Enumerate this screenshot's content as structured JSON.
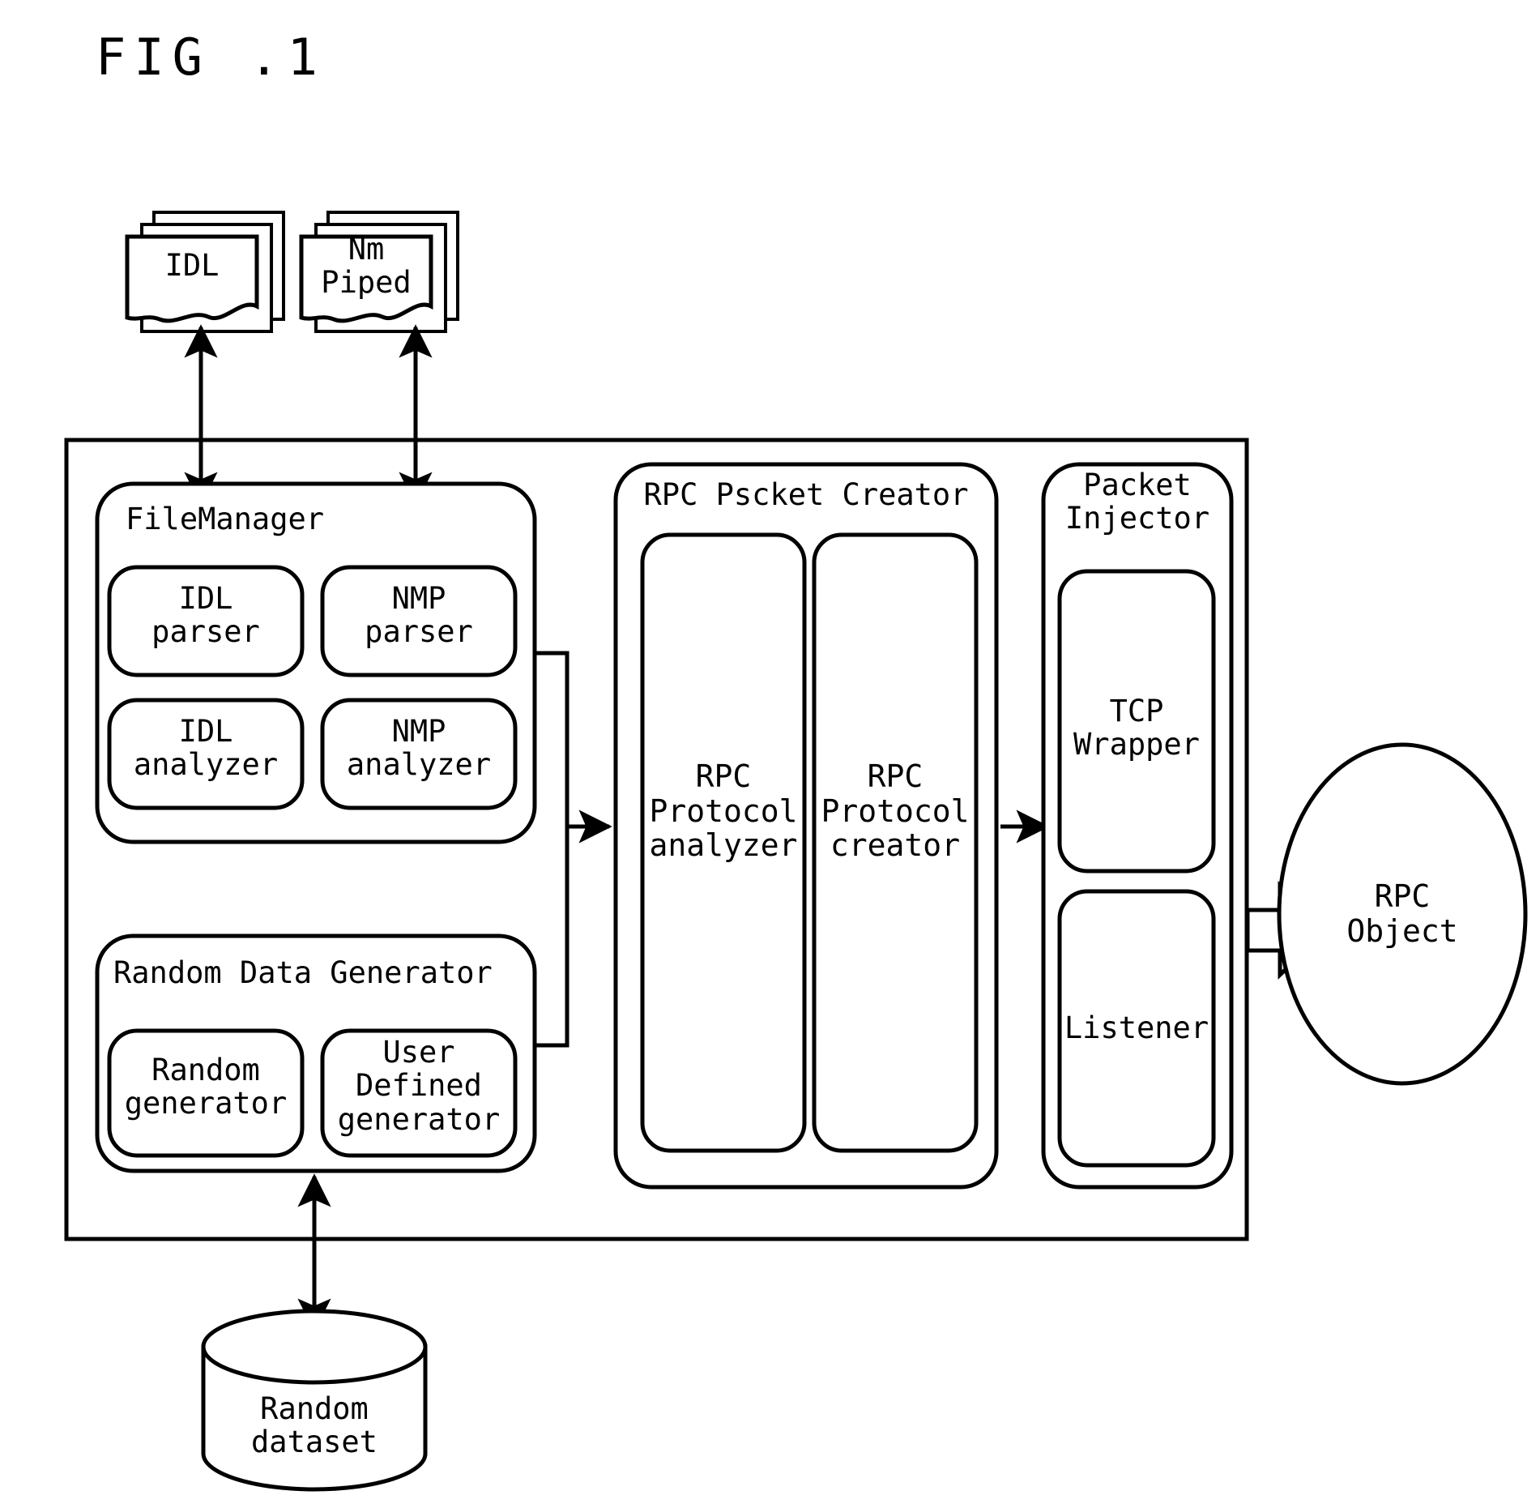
{
  "figure": {
    "title": "FIG .1"
  },
  "documents": [
    {
      "id": "idl-doc",
      "label": "IDL"
    },
    {
      "id": "nm-piped-doc",
      "label": "Nm\nPiped"
    }
  ],
  "system": {
    "file_manager": {
      "title": "FileManager",
      "modules": [
        {
          "id": "idl-parser",
          "label": "IDL\nparser"
        },
        {
          "id": "nmp-parser",
          "label": "NMP\nparser"
        },
        {
          "id": "idl-analyzer",
          "label": "IDL\nanalyzer"
        },
        {
          "id": "nmp-analyzer",
          "label": "NMP\nanalyzer"
        }
      ]
    },
    "random_data_generator": {
      "title": "Random Data Generator",
      "modules": [
        {
          "id": "random-generator",
          "label": "Random\ngenerator"
        },
        {
          "id": "user-defined-generator",
          "label": "User\nDefined\ngenerator"
        }
      ]
    },
    "rpc_packet_creator": {
      "title": "RPC Pscket Creator",
      "modules": [
        {
          "id": "rpc-protocol-analyzer",
          "label": "RPC\nProtocol\nanalyzer"
        },
        {
          "id": "rpc-protocol-creator",
          "label": "RPC\nProtocol\ncreator"
        }
      ]
    },
    "packet_injector": {
      "title": "Packet\nInjector",
      "modules": [
        {
          "id": "tcp-wrapper",
          "label": "TCP\nWrapper"
        },
        {
          "id": "listener",
          "label": "Listener"
        }
      ]
    }
  },
  "external": {
    "rpc_object": {
      "label": "RPC\nObject"
    },
    "random_dataset": {
      "label": "Random\ndataset"
    }
  },
  "connectors": [
    {
      "id": "idl-doc-to-filemanager",
      "type": "double-arrow-vertical"
    },
    {
      "id": "nm-piped-doc-to-filemanager",
      "type": "double-arrow-vertical"
    },
    {
      "id": "filemanager-to-packet-creator",
      "type": "arrow-right"
    },
    {
      "id": "packet-creator-to-injector",
      "type": "arrow-right"
    },
    {
      "id": "injector-to-rpc-object",
      "type": "block-arrow-right"
    },
    {
      "id": "dataset-to-generator",
      "type": "double-arrow-vertical"
    }
  ],
  "style": {
    "stroke": "#000000",
    "fill": "#ffffff"
  }
}
